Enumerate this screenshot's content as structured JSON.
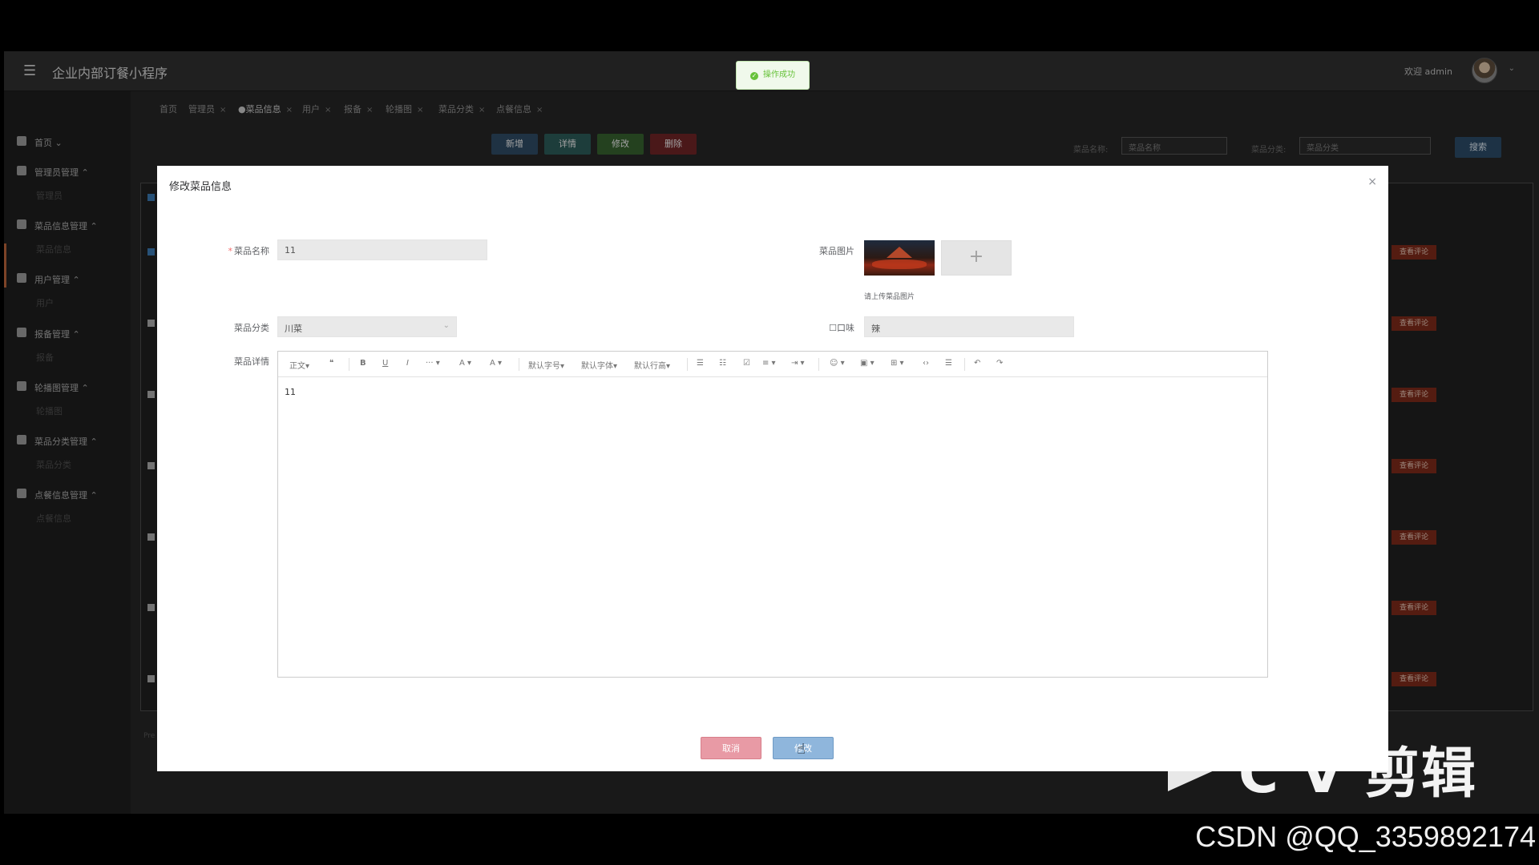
{
  "app": {
    "title": "企业内部订餐小程序",
    "welcome": "欢迎 admin"
  },
  "sidebar": {
    "items": [
      {
        "label": "首页 ⌄",
        "sub": ""
      },
      {
        "label": "管理员管理 ⌃",
        "sub": "管理员"
      },
      {
        "label": "菜品信息管理 ⌃",
        "sub": "菜品信息"
      },
      {
        "label": "用户管理 ⌃",
        "sub": "用户"
      },
      {
        "label": "报备管理 ⌃",
        "sub": "报备"
      },
      {
        "label": "轮播图管理 ⌃",
        "sub": "轮播图"
      },
      {
        "label": "菜品分类管理 ⌃",
        "sub": "菜品分类"
      },
      {
        "label": "点餐信息管理 ⌃",
        "sub": "点餐信息"
      }
    ]
  },
  "tabs": [
    "首页",
    "管理员",
    "●菜品信息",
    "用户",
    "报备",
    "轮播图",
    "菜品分类",
    "点餐信息"
  ],
  "toolbar": {
    "add": "新增",
    "detail": "详情",
    "edit": "修改",
    "delete": "删除"
  },
  "search": {
    "name_label": "菜品名称:",
    "name_placeholder": "菜品名称",
    "category_label": "菜品分类:",
    "category_placeholder": "菜品分类",
    "button": "搜索"
  },
  "table": {
    "row_action": "查看评论",
    "rows": 7,
    "pre": "Pre"
  },
  "toast": {
    "text": "操作成功"
  },
  "dialog": {
    "title": "修改菜品信息",
    "close": "×",
    "fields": {
      "name_label": "菜品名称",
      "name_value": "11",
      "image_label": "菜品图片",
      "upload_hint": "请上传菜品图片",
      "category_label": "菜品分类",
      "category_value": "川菜",
      "taste_label": "口味",
      "taste_value": "辣",
      "detail_label": "菜品详情",
      "detail_value": "11"
    },
    "editor_toolbar": [
      "正文▾",
      "❝",
      "B",
      "U",
      "I",
      "··· ▾",
      "A ▾",
      "A ▾",
      "默认字号▾",
      "默认字体▾",
      "默认行高▾",
      "☰",
      "☷",
      "☑",
      "≡ ▾",
      "⇥ ▾",
      "☺ ▾",
      "▣ ▾",
      "⊞ ▾",
      "‹›",
      "☰",
      "↶",
      "↷"
    ],
    "cancel": "取消",
    "confirm": "修改"
  },
  "watermark": {
    "text": "C V 剪辑",
    "credit": "CSDN @QQ_3359892174"
  }
}
